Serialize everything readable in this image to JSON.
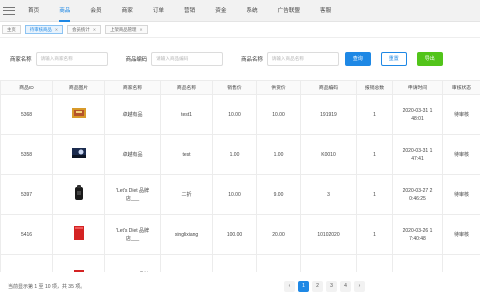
{
  "nav": {
    "items": [
      "首页",
      "商品",
      "会员",
      "商家",
      "订单",
      "营销",
      "资金",
      "系统",
      "广告联盟",
      "客服"
    ],
    "active_index": 1
  },
  "tabs": [
    {
      "label": "主页",
      "active": false
    },
    {
      "label": "待审核商品",
      "active": true
    },
    {
      "label": "会员统计",
      "active": false
    },
    {
      "label": "上架商品管理",
      "active": false
    }
  ],
  "search": {
    "merchant_label": "商家名称",
    "merchant_placeholder": "请输入商家名称",
    "code_label": "商品编码",
    "code_placeholder": "请输入商品编码",
    "name_label": "商品名称",
    "name_placeholder": "请输入商品名称",
    "query_button": "查询",
    "reset_button": "重置",
    "export_button": "导出"
  },
  "table": {
    "headers": [
      "商品ID",
      "商品图片",
      "商家名称",
      "商品名称",
      "销售价",
      "供货价",
      "商品编码",
      "报销总数",
      "申请时间",
      "审核状态"
    ],
    "rows": [
      {
        "id": "5368",
        "merchant": "卓越有品",
        "name": "test1",
        "price": "10.00",
        "supply": "10.00",
        "code": "191919",
        "count": "1",
        "time": "2020-03-31 1\n48:01",
        "status": "待审核"
      },
      {
        "id": "5358",
        "merchant": "卓越有品",
        "name": "test",
        "price": "1.00",
        "supply": "1.00",
        "code": "K0010",
        "count": "1",
        "time": "2020-03-31 1\n47:41",
        "status": "待审核"
      },
      {
        "id": "5397",
        "merchant": "'Let's Diet 品牌\n店___",
        "name": "二折",
        "price": "10.00",
        "supply": "9.00",
        "code": "3",
        "count": "1",
        "time": "2020-03-27 2\n0:46:25",
        "status": "待审核"
      },
      {
        "id": "5416",
        "merchant": "'Let's Diet 品牌\n店___",
        "name": "xinglixiang",
        "price": "100.00",
        "supply": "20.00",
        "code": "10102020",
        "count": "1",
        "time": "2020-03-26 1\n7:40:48",
        "status": "待审核"
      },
      {
        "id": "",
        "merchant": "'Let's Diet 品牌",
        "name": "",
        "price": "",
        "supply": "",
        "code": "",
        "count": "",
        "time": "",
        "status": ""
      }
    ]
  },
  "footer": {
    "summary": "当前显示第 1 至 10 项，共 35 项。",
    "pages": [
      "1",
      "2",
      "3",
      "4"
    ],
    "prev": "‹",
    "next": "›",
    "active_page": "1"
  },
  "colors": {
    "accent": "#1e88e5",
    "success": "#52c41a"
  },
  "icons": {
    "menu": "hamburger-icon"
  }
}
